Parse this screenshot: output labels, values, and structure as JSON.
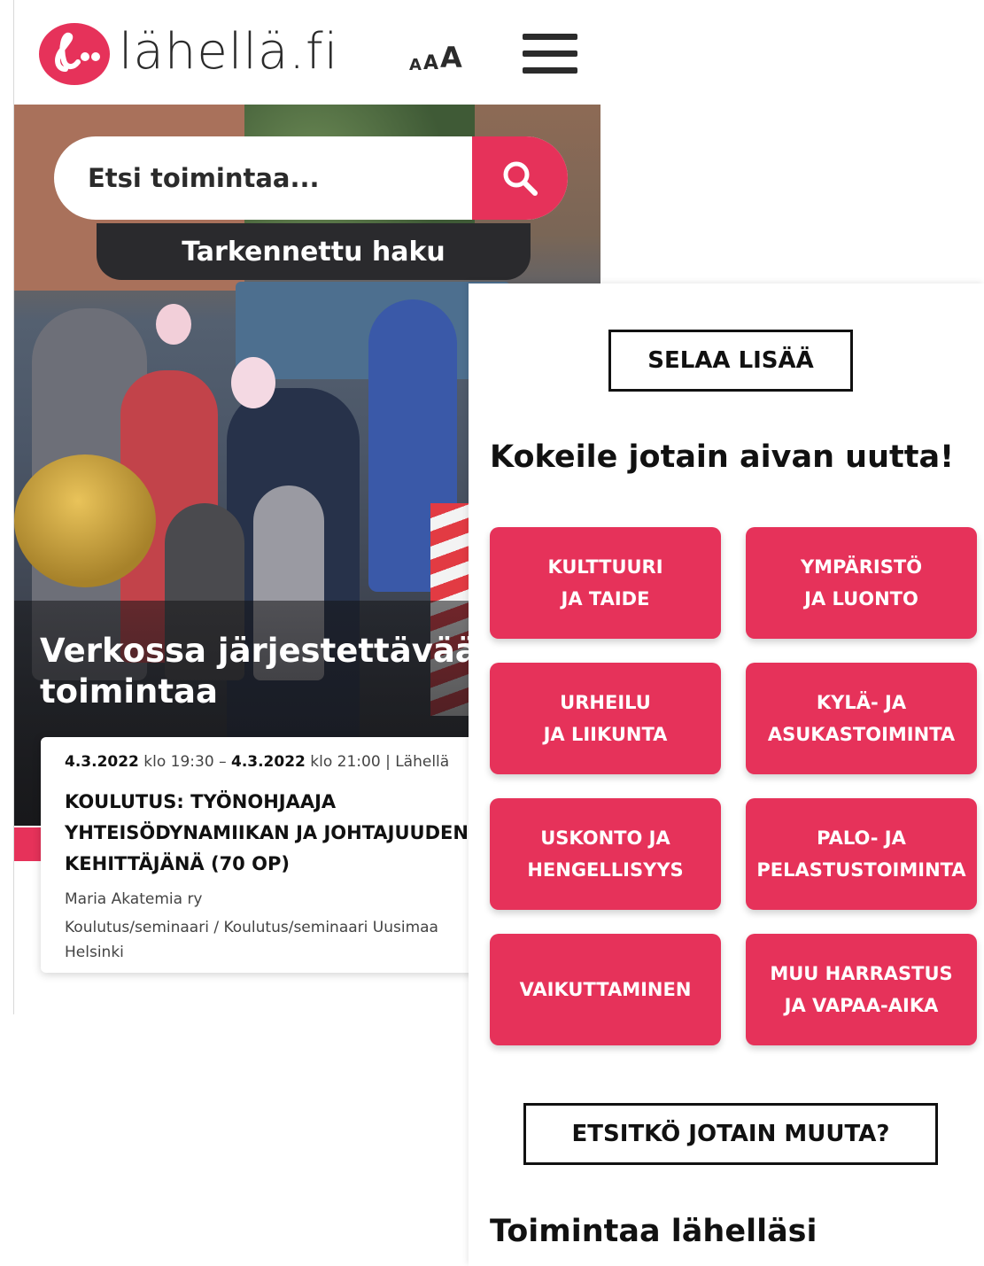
{
  "header": {
    "logo_text": "lähellä.fi",
    "font_size_control": {
      "small": "A",
      "medium": "A",
      "large": "A"
    },
    "menu_icon": "hamburger-icon"
  },
  "search": {
    "placeholder": "Etsi toimintaa...",
    "button_icon": "search-icon",
    "advanced_label": "Tarkennettu haku"
  },
  "feature": {
    "title": "Verkossa järjestettävää toimintaa"
  },
  "event": {
    "start_date": "4.3.2022",
    "start_time": "klo 19:30",
    "separator": "–",
    "end_date": "4.3.2022",
    "end_time": "klo 21:00",
    "source": "| Lähellä",
    "title": "KOULUTUS: TYÖNOHJAAJA\nYHTEISÖDYNAMIIKAN JA JOHTAJUUDEN\nKEHITTÄJÄNÄ (70 OP)",
    "organizer": "Maria Akatemia ry",
    "category": "Koulutus/seminaari / Koulutus/seminaari Uusimaa",
    "city": "Helsinki"
  },
  "right": {
    "browse_more": "SELAA LISÄÄ",
    "try_heading": "Kokeile jotain aivan uutta!",
    "categories": [
      {
        "label": "KULTTUURI\nJA TAIDE"
      },
      {
        "label": "YMPÄRISTÖ\nJA LUONTO"
      },
      {
        "label": "URHEILU\nJA LIIKUNTA"
      },
      {
        "label": "KYLÄ- JA\nASUKASTOIMINTA"
      },
      {
        "label": "USKONTO JA\nHENGELLISYYS"
      },
      {
        "label": "PALO- JA\nPELASTUSTOIMINTA"
      },
      {
        "label": "VAIKUTTAMINEN"
      },
      {
        "label": "MUU HARRASTUS\nJA VAPAA-AIKA"
      }
    ],
    "other_button": "ETSITKÖ JOTAIN MUUTA?",
    "near_heading": "Toimintaa lähelläsi"
  },
  "colors": {
    "brand": "#e6325a",
    "dark": "#2a2a2d",
    "text": "#111111"
  }
}
